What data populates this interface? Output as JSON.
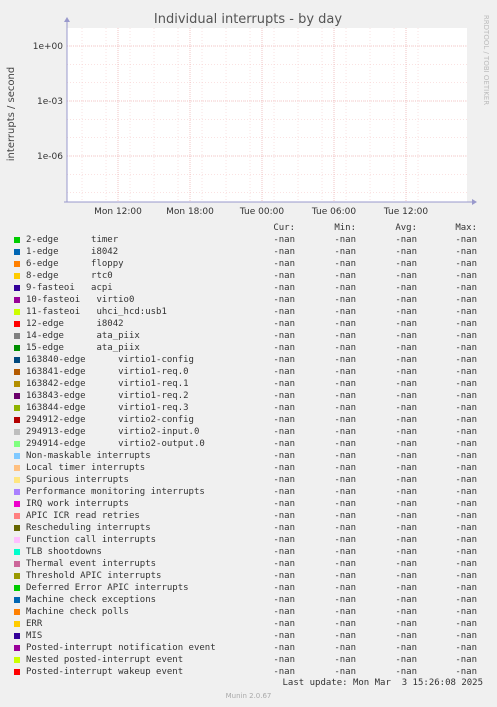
{
  "chart_data": {
    "type": "line",
    "title": "Individual interrupts - by day",
    "ylabel": "interrupts / second",
    "y_scale": "log",
    "y_ticks": [
      {
        "value": 1,
        "label": "1e+00"
      },
      {
        "value": 0.001,
        "label": "1e-03"
      },
      {
        "value": 1e-06,
        "label": "1e-06"
      }
    ],
    "x_ticks": [
      "Mon 12:00",
      "Mon 18:00",
      "Tue 00:00",
      "Tue 06:00",
      "Tue 12:00"
    ],
    "grid": true,
    "side_text": "RRDTOOL / TOBI OETIKER"
  },
  "legend": {
    "headers": {
      "cur": "Cur:",
      "min": "Min:",
      "avg": "Avg:",
      "max": "Max:"
    },
    "rows": [
      {
        "label": "2-edge      timer",
        "color": "#00cc00",
        "cur": "-nan",
        "min": "-nan",
        "avg": "-nan",
        "max": "-nan"
      },
      {
        "label": "1-edge      i8042",
        "color": "#0066b3",
        "cur": "-nan",
        "min": "-nan",
        "avg": "-nan",
        "max": "-nan"
      },
      {
        "label": "6-edge      floppy",
        "color": "#ff8000",
        "cur": "-nan",
        "min": "-nan",
        "avg": "-nan",
        "max": "-nan"
      },
      {
        "label": "8-edge      rtc0",
        "color": "#ffcc00",
        "cur": "-nan",
        "min": "-nan",
        "avg": "-nan",
        "max": "-nan"
      },
      {
        "label": "9-fasteoi   acpi",
        "color": "#330099",
        "cur": "-nan",
        "min": "-nan",
        "avg": "-nan",
        "max": "-nan"
      },
      {
        "label": "10-fasteoi   virtio0",
        "color": "#990099",
        "cur": "-nan",
        "min": "-nan",
        "avg": "-nan",
        "max": "-nan"
      },
      {
        "label": "11-fasteoi   uhci_hcd:usb1",
        "color": "#ccff00",
        "cur": "-nan",
        "min": "-nan",
        "avg": "-nan",
        "max": "-nan"
      },
      {
        "label": "12-edge      i8042",
        "color": "#ff0000",
        "cur": "-nan",
        "min": "-nan",
        "avg": "-nan",
        "max": "-nan"
      },
      {
        "label": "14-edge      ata_piix",
        "color": "#808080",
        "cur": "-nan",
        "min": "-nan",
        "avg": "-nan",
        "max": "-nan"
      },
      {
        "label": "15-edge      ata_piix",
        "color": "#008f00",
        "cur": "-nan",
        "min": "-nan",
        "avg": "-nan",
        "max": "-nan"
      },
      {
        "label": "163840-edge      virtio1-config",
        "color": "#00487d",
        "cur": "-nan",
        "min": "-nan",
        "avg": "-nan",
        "max": "-nan"
      },
      {
        "label": "163841-edge      virtio1-req.0",
        "color": "#b35a00",
        "cur": "-nan",
        "min": "-nan",
        "avg": "-nan",
        "max": "-nan"
      },
      {
        "label": "163842-edge      virtio1-req.1",
        "color": "#b38f00",
        "cur": "-nan",
        "min": "-nan",
        "avg": "-nan",
        "max": "-nan"
      },
      {
        "label": "163843-edge      virtio1-req.2",
        "color": "#6b006b",
        "cur": "-nan",
        "min": "-nan",
        "avg": "-nan",
        "max": "-nan"
      },
      {
        "label": "163844-edge      virtio1-req.3",
        "color": "#8fb300",
        "cur": "-nan",
        "min": "-nan",
        "avg": "-nan",
        "max": "-nan"
      },
      {
        "label": "294912-edge      virtio2-config",
        "color": "#b30000",
        "cur": "-nan",
        "min": "-nan",
        "avg": "-nan",
        "max": "-nan"
      },
      {
        "label": "294913-edge      virtio2-input.0",
        "color": "#bebebe",
        "cur": "-nan",
        "min": "-nan",
        "avg": "-nan",
        "max": "-nan"
      },
      {
        "label": "294914-edge      virtio2-output.0",
        "color": "#80ff80",
        "cur": "-nan",
        "min": "-nan",
        "avg": "-nan",
        "max": "-nan"
      },
      {
        "label": "Non-maskable interrupts",
        "color": "#80c9ff",
        "cur": "-nan",
        "min": "-nan",
        "avg": "-nan",
        "max": "-nan"
      },
      {
        "label": "Local timer interrupts",
        "color": "#ffc080",
        "cur": "-nan",
        "min": "-nan",
        "avg": "-nan",
        "max": "-nan"
      },
      {
        "label": "Spurious interrupts",
        "color": "#ffe680",
        "cur": "-nan",
        "min": "-nan",
        "avg": "-nan",
        "max": "-nan"
      },
      {
        "label": "Performance monitoring interrupts",
        "color": "#aa80ff",
        "cur": "-nan",
        "min": "-nan",
        "avg": "-nan",
        "max": "-nan"
      },
      {
        "label": "IRQ work interrupts",
        "color": "#ee00cc",
        "cur": "-nan",
        "min": "-nan",
        "avg": "-nan",
        "max": "-nan"
      },
      {
        "label": "APIC ICR read retries",
        "color": "#ff8080",
        "cur": "-nan",
        "min": "-nan",
        "avg": "-nan",
        "max": "-nan"
      },
      {
        "label": "Rescheduling interrupts",
        "color": "#666600",
        "cur": "-nan",
        "min": "-nan",
        "avg": "-nan",
        "max": "-nan"
      },
      {
        "label": "Function call interrupts",
        "color": "#ffbfff",
        "cur": "-nan",
        "min": "-nan",
        "avg": "-nan",
        "max": "-nan"
      },
      {
        "label": "TLB shootdowns",
        "color": "#00ffcc",
        "cur": "-nan",
        "min": "-nan",
        "avg": "-nan",
        "max": "-nan"
      },
      {
        "label": "Thermal event interrupts",
        "color": "#cc6699",
        "cur": "-nan",
        "min": "-nan",
        "avg": "-nan",
        "max": "-nan"
      },
      {
        "label": "Threshold APIC interrupts",
        "color": "#999900",
        "cur": "-nan",
        "min": "-nan",
        "avg": "-nan",
        "max": "-nan"
      },
      {
        "label": "Deferred Error APIC interrupts",
        "color": "#00cc00",
        "cur": "-nan",
        "min": "-nan",
        "avg": "-nan",
        "max": "-nan"
      },
      {
        "label": "Machine check exceptions",
        "color": "#0066b3",
        "cur": "-nan",
        "min": "-nan",
        "avg": "-nan",
        "max": "-nan"
      },
      {
        "label": "Machine check polls",
        "color": "#ff8000",
        "cur": "-nan",
        "min": "-nan",
        "avg": "-nan",
        "max": "-nan"
      },
      {
        "label": "ERR",
        "color": "#ffcc00",
        "cur": "-nan",
        "min": "-nan",
        "avg": "-nan",
        "max": "-nan"
      },
      {
        "label": "MIS",
        "color": "#330099",
        "cur": "-nan",
        "min": "-nan",
        "avg": "-nan",
        "max": "-nan"
      },
      {
        "label": "Posted-interrupt notification event",
        "color": "#990099",
        "cur": "-nan",
        "min": "-nan",
        "avg": "-nan",
        "max": "-nan"
      },
      {
        "label": "Nested posted-interrupt event",
        "color": "#ccff00",
        "cur": "-nan",
        "min": "-nan",
        "avg": "-nan",
        "max": "-nan"
      },
      {
        "label": "Posted-interrupt wakeup event",
        "color": "#ff0000",
        "cur": "-nan",
        "min": "-nan",
        "avg": "-nan",
        "max": "-nan"
      }
    ]
  },
  "footer": {
    "last_update": "Last update: Mon Mar  3 15:26:08 2025",
    "version": "Munin 2.0.67"
  }
}
